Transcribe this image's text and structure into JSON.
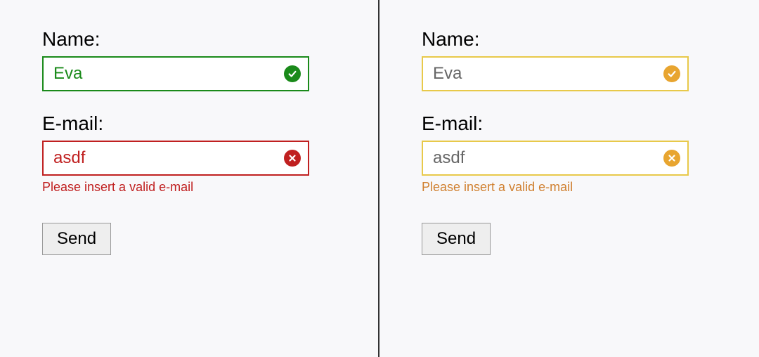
{
  "left_form": {
    "name_label": "Name:",
    "name_value": "Eva",
    "email_label": "E-mail:",
    "email_value": "asdf",
    "email_error": "Please insert a valid e-mail",
    "submit_label": "Send"
  },
  "right_form": {
    "name_label": "Name:",
    "name_value": "Eva",
    "email_label": "E-mail:",
    "email_value": "asdf",
    "email_error": "Please insert a valid e-mail",
    "submit_label": "Send"
  },
  "colors": {
    "valid_left": "#1a8a1a",
    "invalid_left": "#c02020",
    "accent_right": "#e8c94a",
    "icon_right": "#e8a530",
    "error_right": "#d08030"
  }
}
